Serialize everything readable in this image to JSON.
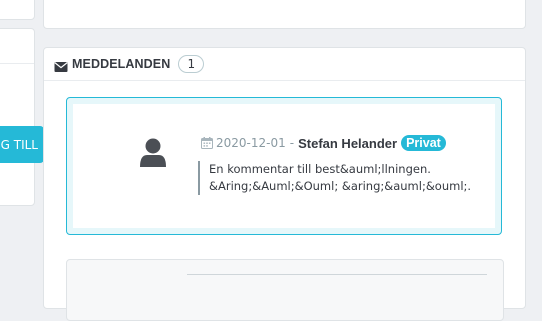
{
  "sidebar": {
    "add_button_label": "G TILL"
  },
  "messages": {
    "header_title": "MEDDELANDEN",
    "count": "1",
    "items": [
      {
        "date": "2020-12-01",
        "separator": "-",
        "author": "Stefan Helander",
        "badge": "Privat",
        "text": "En kommentar till best&auml;llningen. &Aring;&Auml;&Ouml; &aring;&auml;&ouml;."
      }
    ]
  },
  "icons": {
    "header": "envelope-icon",
    "avatar": "user-icon",
    "date": "calendar-icon"
  },
  "colors": {
    "accent": "#25b9d7",
    "text": "#363a41",
    "muted": "#8a9aa2",
    "background": "#eef0f3"
  }
}
